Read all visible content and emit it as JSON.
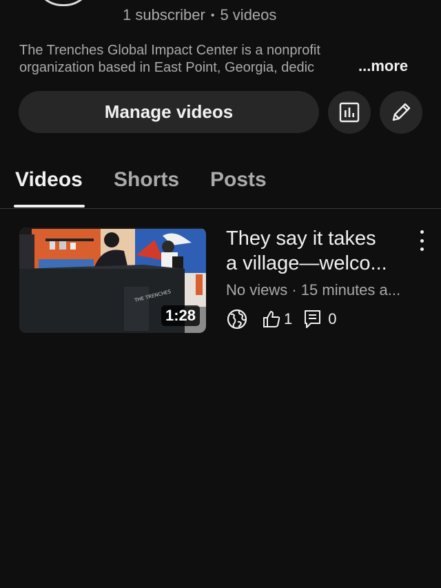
{
  "channel": {
    "subscribers": "1 subscriber",
    "separator": "•",
    "videos": "5 videos",
    "description_line1": "The Trenches Global Impact Center is a nonprofit",
    "description_line2": "organization based in East Point, Georgia, dedic",
    "more_label": "...more"
  },
  "actions": {
    "manage_videos": "Manage videos",
    "analytics_icon": "analytics-icon",
    "edit_icon": "pencil-icon"
  },
  "tabs": [
    {
      "label": "Videos",
      "active": true
    },
    {
      "label": "Shorts",
      "active": false
    },
    {
      "label": "Posts",
      "active": false
    }
  ],
  "videos": [
    {
      "title_line1": "They say it takes",
      "title_line2": "a village—welco...",
      "duration": "1:28",
      "meta": "No views · 15 minutes a...",
      "visibility_icon": "globe-icon",
      "likes": "1",
      "comments": "0",
      "thumbnail_text": "THE TRENCHES"
    }
  ],
  "colors": {
    "background": "#0f0f0f",
    "surface": "#272727",
    "text_primary": "#f1f1f1",
    "text_secondary": "#aaaaaa"
  }
}
